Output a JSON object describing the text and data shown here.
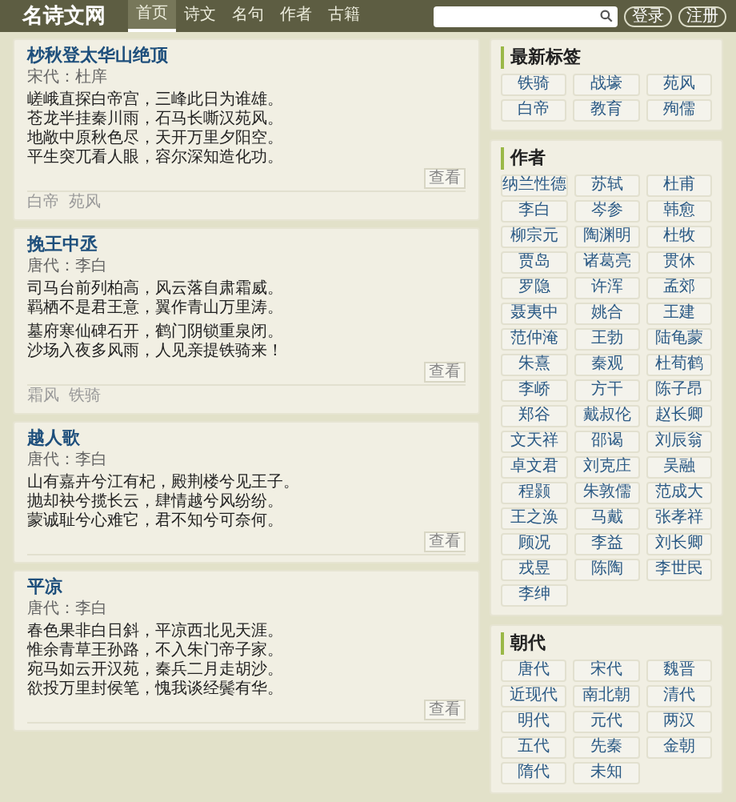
{
  "header": {
    "logo": "名诗文网",
    "nav": [
      {
        "label": "首页",
        "selected": true
      },
      {
        "label": "诗文",
        "selected": false
      },
      {
        "label": "名句",
        "selected": false
      },
      {
        "label": "作者",
        "selected": false
      },
      {
        "label": "古籍",
        "selected": false
      }
    ],
    "buttons": [
      "登录",
      "注册"
    ]
  },
  "poems": [
    {
      "title": "杪秋登太华山绝顶",
      "meta": "宋代：杜庠",
      "stanzas": [
        [
          "嵯峨直探白帝宫，三峰此日为谁雄。",
          "苍龙半挂秦川雨，石马长嘶汉苑风。",
          "地敞中原秋色尽，天开万里夕阳空。",
          "平生突兀看人眼，容尔深知造化功。"
        ]
      ],
      "button": "查看",
      "tags": [
        "白帝",
        "苑风"
      ]
    },
    {
      "title": "挽王中丞",
      "meta": "唐代：李白",
      "stanzas": [
        [
          "司马台前列柏高，风云落自肃霜威。",
          "羁栖不是君王意，翼作青山万里涛。"
        ],
        [
          "墓府寒仙碑石开，鹤门阴锁重泉闭。",
          "沙场入夜多风雨，人见亲提铁骑来！"
        ]
      ],
      "button": "查看",
      "tags": [
        "霜风",
        "铁骑"
      ]
    },
    {
      "title": "越人歌",
      "meta": "唐代：李白",
      "stanzas": [
        [
          "山有嘉卉兮江有杞，殿荆楼兮见王子。",
          "抛却袂兮揽长云，肆情越兮风纷纷。",
          "蒙诚耻兮心难它，君不知兮可奈何。"
        ]
      ],
      "button": "查看"
    },
    {
      "title": "平凉",
      "meta": "唐代：李白",
      "stanzas": [
        [
          "春色果非白日斜，平凉西北见天涯。",
          "惟余青草王孙路，不入朱门帝子家。",
          "宛马如云开汉苑，秦兵二月走胡沙。",
          "欲投万里封侯笔，愧我谈经鬓有华。"
        ]
      ],
      "button": "查看"
    }
  ],
  "sidebar": [
    {
      "title": "最新标签",
      "items": [
        "铁骑",
        "战壕",
        "苑风",
        "白帝",
        "教育",
        "殉儒"
      ]
    },
    {
      "title": "作者",
      "items": [
        "纳兰性德",
        "苏轼",
        "杜甫",
        "李白",
        "岑参",
        "韩愈",
        "柳宗元",
        "陶渊明",
        "杜牧",
        "贾岛",
        "诸葛亮",
        "贯休",
        "罗隐",
        "许浑",
        "孟郊",
        "聂夷中",
        "姚合",
        "王建",
        "范仲淹",
        "王勃",
        "陆龟蒙",
        "朱熹",
        "秦观",
        "杜荀鹤",
        "李峤",
        "方干",
        "陈子昂",
        "郑谷",
        "戴叔伦",
        "赵长卿",
        "文天祥",
        "邵谒",
        "刘辰翁",
        "卓文君",
        "刘克庄",
        "吴融",
        "程颢",
        "朱敦儒",
        "范成大",
        "王之涣",
        "马戴",
        "张孝祥",
        "顾况",
        "李益",
        "刘长卿",
        "戎昱",
        "陈陶",
        "李世民",
        "李绅"
      ]
    },
    {
      "title": "朝代",
      "items": [
        "唐代",
        "宋代",
        "魏晋",
        "近现代",
        "南北朝",
        "清代",
        "明代",
        "元代",
        "两汉",
        "五代",
        "先秦",
        "金朝",
        "隋代",
        "未知"
      ]
    }
  ]
}
